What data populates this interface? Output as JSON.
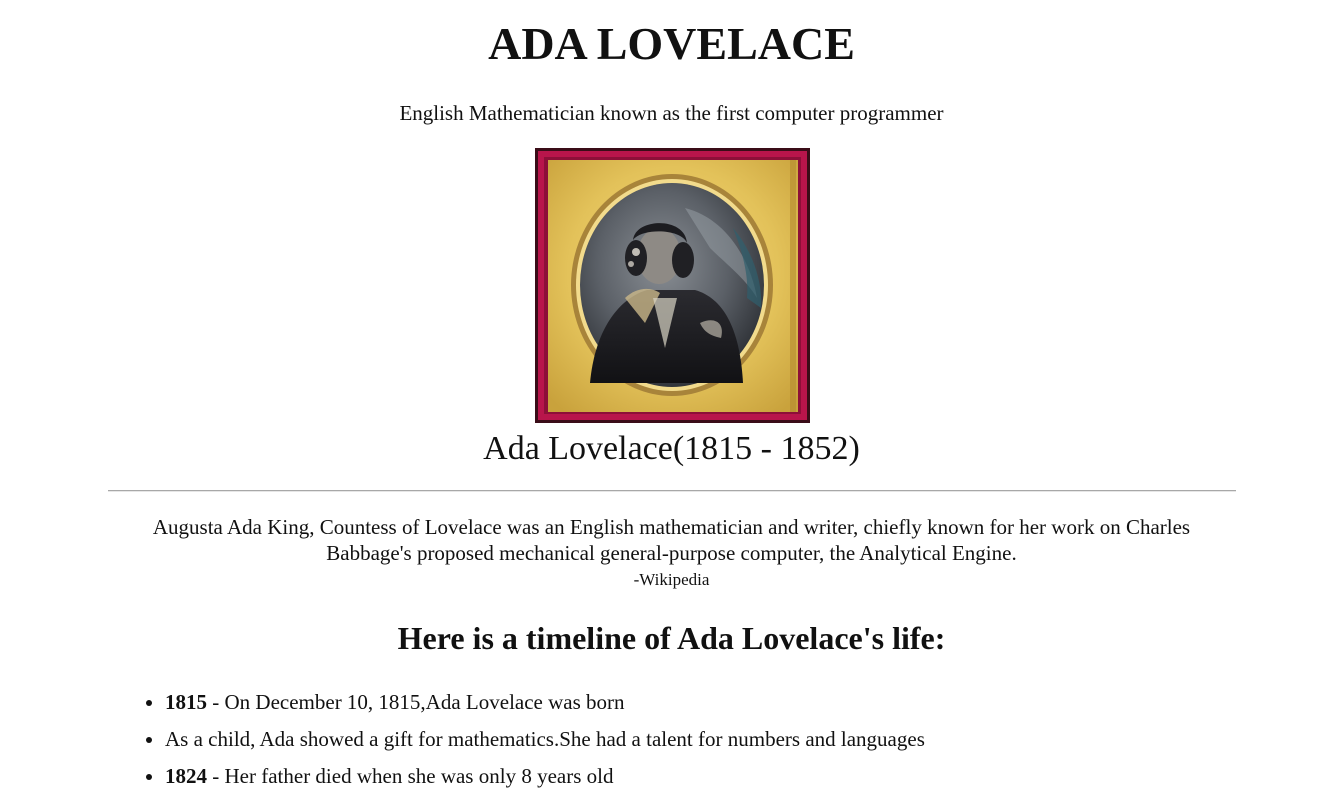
{
  "page": {
    "title": "ADA LOVELACE",
    "subtitle": "English Mathematician known as the first computer programmer",
    "image_caption": "Ada Lovelace(1815 - 1852)",
    "quote": "Augusta Ada King, Countess of Lovelace was an English mathematician and writer, chiefly known for her work on Charles Babbage's proposed mechanical general-purpose computer, the Analytical Engine.",
    "quote_source": "-Wikipedia",
    "timeline_heading": "Here is a timeline of Ada Lovelace's life:"
  },
  "portrait": {
    "frame_outer_color": "#c2184f",
    "frame_gold_color": "#e3c25a",
    "photo_color": "#3c4046"
  },
  "timeline": [
    {
      "year": "1815",
      "text": " - On December 10, 1815,Ada Lovelace was born"
    },
    {
      "year": "",
      "text": "As a child, Ada showed a gift for mathematics.She had a talent for numbers and languages"
    },
    {
      "year": "1824",
      "text": " - Her father died when she was only 8 years old"
    }
  ]
}
